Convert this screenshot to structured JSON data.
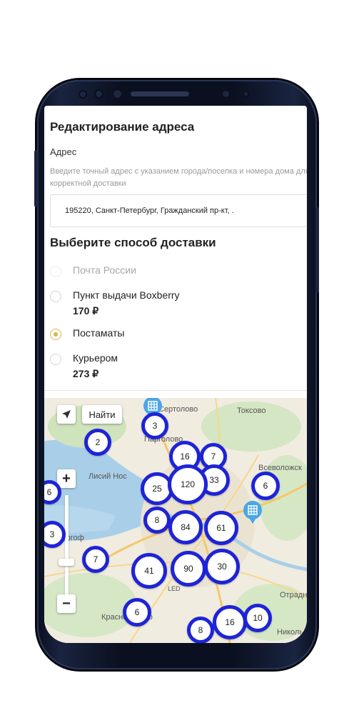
{
  "form": {
    "title": "Редактирование адреса",
    "address_label": "Адрес",
    "address_hint": "Введите точный адрес с указанием города/поселка и номера дома для корректной доставки",
    "address_value": "195220, Санкт-Петербург, Гражданский пр-кт, ."
  },
  "delivery": {
    "title": "Выберите способ доставки",
    "options": [
      {
        "label": "Почта России",
        "price": "",
        "state": "disabled"
      },
      {
        "label": "Пункт выдачи Boxberry",
        "price": "170 ₽",
        "state": "unselected"
      },
      {
        "label": "Постаматы",
        "price": "",
        "state": "selected"
      },
      {
        "label": "Курьером",
        "price": "273 ₽",
        "state": "unselected"
      }
    ]
  },
  "map": {
    "find_button": "Найти",
    "zoom_in": "+",
    "zoom_out": "−",
    "place_labels": [
      "Сертолово",
      "Токсово",
      "Парголово",
      "Лисий Нос",
      "Всеволожск",
      "Петергоф",
      "Отрадное",
      "Красное Село",
      "Никольское",
      "LED"
    ],
    "cluster_counts": [
      "2",
      "3",
      "16",
      "7",
      "25",
      "120",
      "33",
      "6",
      "8",
      "84",
      "61",
      "3",
      "7",
      "41",
      "90",
      "30",
      "6",
      "16",
      "10",
      "8",
      "6"
    ],
    "cluster_color": "#1e24d6",
    "pin_color": "#4aa6e8",
    "pin_icon": "parcel-locker-icon"
  },
  "colors": {
    "radio_selected": "#d6b74a",
    "phone_frame": "#0b1020"
  }
}
